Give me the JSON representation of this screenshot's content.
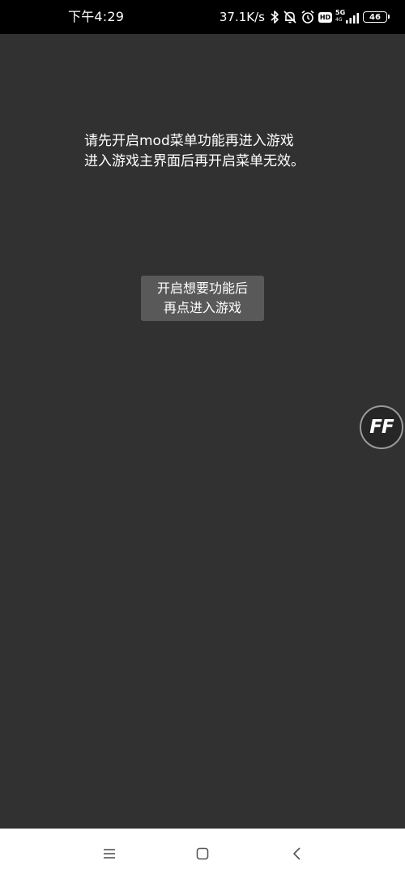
{
  "status_bar": {
    "time": "下午4:29",
    "net_speed": "37.1K/s",
    "hd_label": "HD",
    "signal_5g": "5G",
    "signal_4g": "4G",
    "battery": "46",
    "icons": [
      "bluetooth-icon",
      "mute-bell-icon",
      "alarm-icon",
      "hd-icon",
      "signal-icon",
      "battery-icon"
    ]
  },
  "message": {
    "line1": "请先开启mod菜单功能再进入游戏",
    "line2": "进入游戏主界面后再开启菜单无效。"
  },
  "enter_button": {
    "line1": "开启想要功能后",
    "line2": "再点进入游戏"
  },
  "float_button": {
    "label": "FF"
  },
  "nav_bar": {
    "icons": [
      "menu-icon",
      "home-icon",
      "back-icon"
    ]
  },
  "colors": {
    "background": "#313131",
    "status_bar": "#000000",
    "button": "#595959",
    "nav_bar": "#ffffff"
  }
}
